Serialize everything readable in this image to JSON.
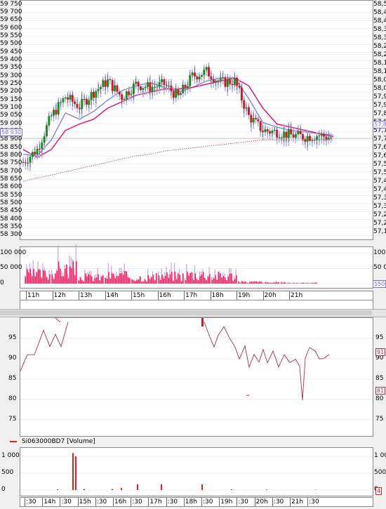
{
  "colors": {
    "candle_up": "#1e8c1e",
    "candle_down": "#c81e28",
    "shadow": "#b0b0dc",
    "ma_fast": "#7b7bd8",
    "ma_slow": "#e0197f",
    "ma_long": "#a05050",
    "vol_bar": "#ff2050",
    "vol_shadow": "#c8a0e0",
    "line2": "#a0304a",
    "grid": "#e0e0e0"
  },
  "chart_top": {
    "left_ticks": [
      "59 750",
      "59 700",
      "59 650",
      "59 600",
      "59 550",
      "59 500",
      "59 450",
      "59 400",
      "59 350",
      "59 300",
      "59 250",
      "59 200",
      "59 150",
      "59 100",
      "59 050",
      "59 000",
      "58 950",
      "58 900",
      "58 850",
      "58 800",
      "58 750",
      "58 700",
      "58 650",
      "58 600",
      "58 550",
      "58 500",
      "58 450",
      "58 400",
      "58 350",
      "58 300"
    ],
    "right_ticks": [
      "58,5",
      "58,4",
      "58,4",
      "58,3",
      "58,3",
      "58,2",
      "58,2",
      "58,1",
      "58,1",
      "58,0",
      "58,0",
      "57,9",
      "57,9",
      "57,8",
      "57,8",
      "57,7",
      "57,7",
      "57,6",
      "57,6",
      "57,5",
      "57,5",
      "57,4",
      "57,4",
      "57,3",
      "57,3",
      "57,2",
      "57,2",
      "57,1"
    ],
    "left_marker": "58 930",
    "right_marker": "57,8"
  },
  "chart_vol": {
    "left_ticks": [
      "100 000",
      "50 000",
      "0"
    ],
    "right_ticks": [
      "100",
      "50 0"
    ],
    "right_marker": "550"
  },
  "time_axis_1": [
    "11h",
    "12h",
    "13h",
    "14h",
    "15h",
    "16h",
    "17h",
    "18h",
    "19h",
    "20h",
    "21h"
  ],
  "chart_line": {
    "left_ticks": [
      "95",
      "90",
      "85",
      "80",
      "75"
    ],
    "right_ticks": [
      "95",
      "90",
      "85",
      "80",
      "75"
    ],
    "right_markers": [
      "91",
      "81"
    ]
  },
  "chart_vol2": {
    "legend": "Si063000BD7 [Volume]",
    "left_ticks": [
      "1 000",
      "500",
      "0"
    ],
    "right_ticks": [
      "1 00",
      "500",
      "0"
    ],
    "right_marker": "4"
  },
  "time_axis_2": [
    ":30",
    "14h",
    ":30",
    "15h",
    ":30",
    "16h",
    ":30",
    "17h",
    ":30",
    "18h",
    ":30",
    "19h",
    ":30",
    "20h",
    ":30",
    "21h",
    ":30"
  ],
  "chart_data": [
    {
      "type": "candlestick",
      "title": "",
      "xlabel": "",
      "ylabel": "",
      "x": [
        "10:40",
        "11h",
        "11:30",
        "12h",
        "12:30",
        "13h",
        "13:30",
        "14h",
        "14:30",
        "15h",
        "15:30",
        "16h",
        "16:30",
        "17h",
        "17:30",
        "18h",
        "18:30",
        "19h",
        "19:30",
        "20h",
        "20:30",
        "21h",
        "21:30"
      ],
      "series": [
        {
          "values": [
            58760,
            58840,
            59050,
            59170,
            59110,
            59200,
            59270,
            59170,
            59250,
            59230,
            59250,
            59170,
            59300,
            59330,
            59260,
            59270,
            59050,
            58960,
            58950,
            58930,
            58920,
            58930,
            58910
          ]
        },
        {
          "values": [
            58810,
            58800,
            58900,
            59070,
            59030,
            59080,
            59150,
            59210,
            59240,
            59260,
            59230,
            59200,
            59230,
            59270,
            59290,
            59290,
            59160,
            59010,
            58980,
            58960,
            58950,
            58940,
            58930
          ]
        },
        {
          "values": [
            58840,
            58790,
            58840,
            58960,
            59000,
            59030,
            59100,
            59140,
            59180,
            59200,
            59220,
            59220,
            59230,
            59250,
            59270,
            59290,
            59240,
            59100,
            59000,
            58980,
            58960,
            58940,
            58920
          ]
        },
        {
          "values": [
            58640,
            58660,
            58680,
            58700,
            58720,
            58740,
            58760,
            58780,
            58800,
            58810,
            58830,
            58840,
            58850,
            58860,
            58870,
            58880,
            58890,
            58900,
            58900,
            58900,
            58900,
            58900,
            58900
          ]
        }
      ],
      "ylim": [
        58275,
        59775
      ],
      "grid": true
    },
    {
      "type": "bar",
      "title": "",
      "categories": [
        "11h",
        "12h",
        "13h",
        "14h",
        "15h",
        "16h",
        "17h",
        "18h",
        "19h",
        "20h",
        "21h"
      ],
      "values": [
        30000,
        45000,
        20000,
        25000,
        20000,
        25000,
        30000,
        25000,
        5000,
        3000,
        2000
      ],
      "ylim": [
        0,
        120000
      ]
    },
    {
      "type": "line",
      "title": "",
      "x": [
        "11h",
        "12h",
        "13h",
        "14h",
        "18h",
        "18:30",
        "19h",
        "19:30",
        "20h",
        "20:30",
        "21h",
        "21:30"
      ],
      "series": [
        {
          "values": [
            87,
            91,
            95,
            100,
            99,
            94,
            90,
            89,
            89,
            88,
            79,
            90
          ]
        }
      ],
      "ylim": [
        71,
        100
      ]
    },
    {
      "type": "bar",
      "title": "",
      "categories": [
        ":30",
        "14h",
        ":30",
        "15h",
        ":30",
        "16h",
        ":30",
        "17h",
        ":30",
        "18h",
        ":30",
        "19h",
        ":30",
        "20h",
        ":30",
        "21h",
        ":30"
      ],
      "series": [
        {
          "name": "Si063000BD7 [Volume]",
          "values": [
            0,
            1100,
            20,
            30,
            30,
            0,
            60,
            20,
            0,
            170,
            0,
            0,
            0,
            0,
            0,
            0,
            0
          ]
        }
      ],
      "ylim": [
        0,
        1250
      ]
    }
  ]
}
